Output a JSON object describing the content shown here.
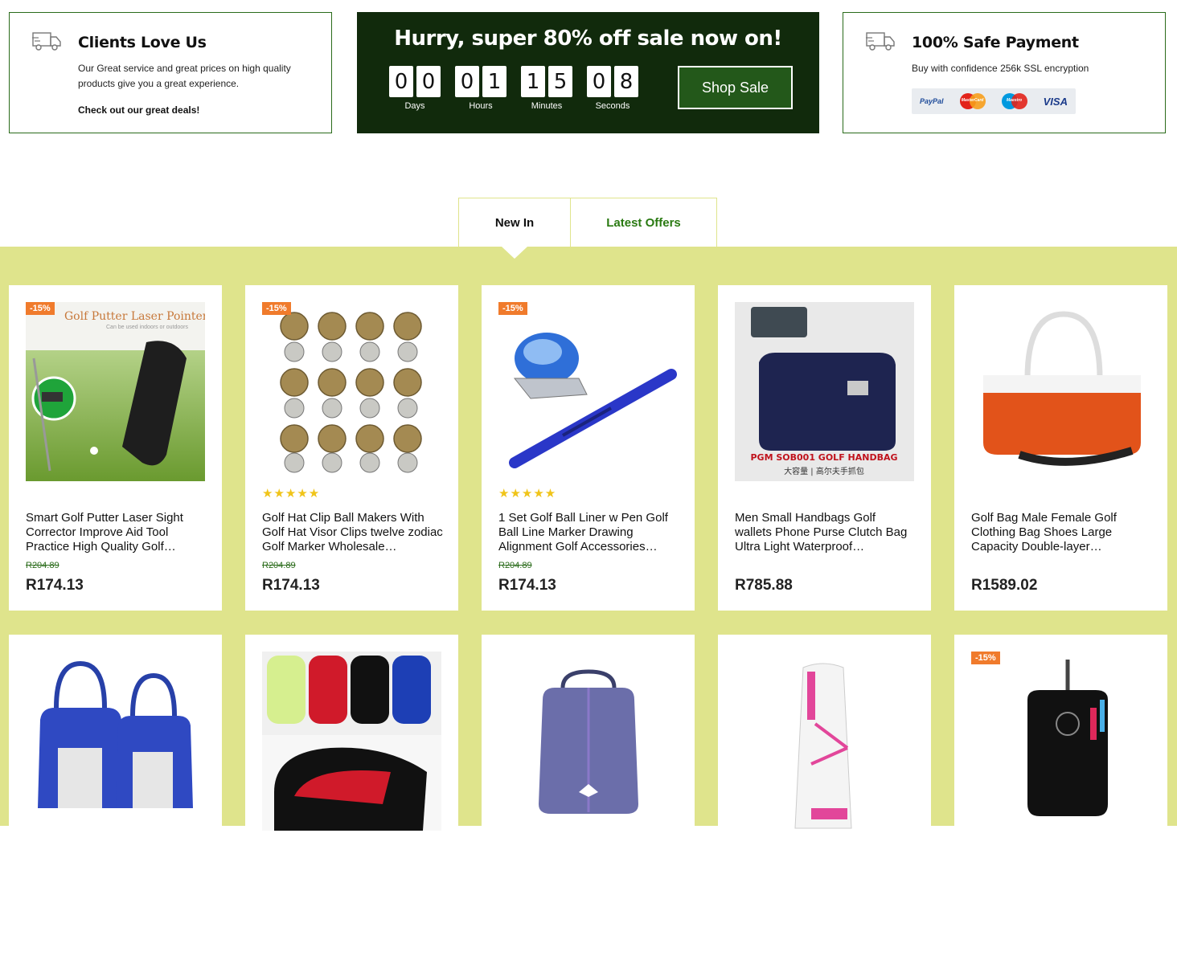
{
  "info_left": {
    "title": "Clients Love Us",
    "text": "Our Great service and great prices on high quality products give you a great experience.",
    "cta": "Check out our great deals!"
  },
  "sale": {
    "title": "Hurry, super 80% off sale now on!",
    "countdown": [
      {
        "digits": [
          "0",
          "0"
        ],
        "label": "Days"
      },
      {
        "digits": [
          "0",
          "1"
        ],
        "label": "Hours"
      },
      {
        "digits": [
          "1",
          "5"
        ],
        "label": "Minutes"
      },
      {
        "digits": [
          "0",
          "8"
        ],
        "label": "Seconds"
      }
    ],
    "button": "Shop Sale"
  },
  "info_right": {
    "title": "100% Safe Payment",
    "text": "Buy with confidence 256k SSL encryption",
    "payment_methods": [
      "PayPal",
      "MasterCard",
      "Maestro",
      "VISA"
    ]
  },
  "tabs": [
    "New In",
    "Latest Offers"
  ],
  "colors": {
    "accent_green": "#2a7a12",
    "banner_bg": "#112a0c",
    "product_bg": "#dfe48c",
    "badge": "#f07b2c",
    "star": "#f0c419"
  },
  "products": [
    {
      "badge": "-15%",
      "title": "Smart Golf Putter Laser Sight Corrector Improve Aid Tool Practice High Quality Golf…",
      "old_price": "R204.89",
      "price": "R174.13",
      "stars": "",
      "image": "Golf Putter Laser Pointer",
      "image_subtitle": "Can be used indoors or outdoors"
    },
    {
      "badge": "-15%",
      "title": "Golf Hat Clip Ball Makers With Golf Hat Visor Clips twelve zodiac Golf Marker Wholesale…",
      "old_price": "R204.89",
      "price": "R174.13",
      "stars": "★★★★★",
      "image": "",
      "image_subtitle": ""
    },
    {
      "badge": "-15%",
      "title": "1 Set Golf Ball Liner w Pen Golf Ball Line Marker Drawing Alignment Golf Accessories…",
      "old_price": "R204.89",
      "price": "R174.13",
      "stars": "★★★★★",
      "image": "",
      "image_subtitle": ""
    },
    {
      "badge": "",
      "title": "Men Small Handbags Golf wallets Phone Purse Clutch Bag Ultra Light Waterproof…",
      "old_price": "",
      "price": "R785.88",
      "stars": "",
      "image": "PGM SOB001 GOLF HANDBAG",
      "image_subtitle": "大容量 | 高尔夫手抓包"
    },
    {
      "badge": "",
      "title": "Golf Bag Male Female Golf Clothing Bag Shoes Large Capacity Double-layer…",
      "old_price": "",
      "price": "R1589.02",
      "stars": "",
      "image": "",
      "image_subtitle": ""
    },
    {
      "badge": "",
      "title": "",
      "old_price": "",
      "price": "",
      "stars": "",
      "image": "",
      "image_subtitle": ""
    },
    {
      "badge": "",
      "title": "",
      "old_price": "",
      "price": "",
      "stars": "",
      "image": "",
      "image_subtitle": ""
    },
    {
      "badge": "",
      "title": "",
      "old_price": "",
      "price": "",
      "stars": "",
      "image": "",
      "image_subtitle": ""
    },
    {
      "badge": "",
      "title": "",
      "old_price": "",
      "price": "",
      "stars": "",
      "image": "",
      "image_subtitle": ""
    },
    {
      "badge": "-15%",
      "title": "",
      "old_price": "",
      "price": "",
      "stars": "",
      "image": "",
      "image_subtitle": ""
    }
  ]
}
